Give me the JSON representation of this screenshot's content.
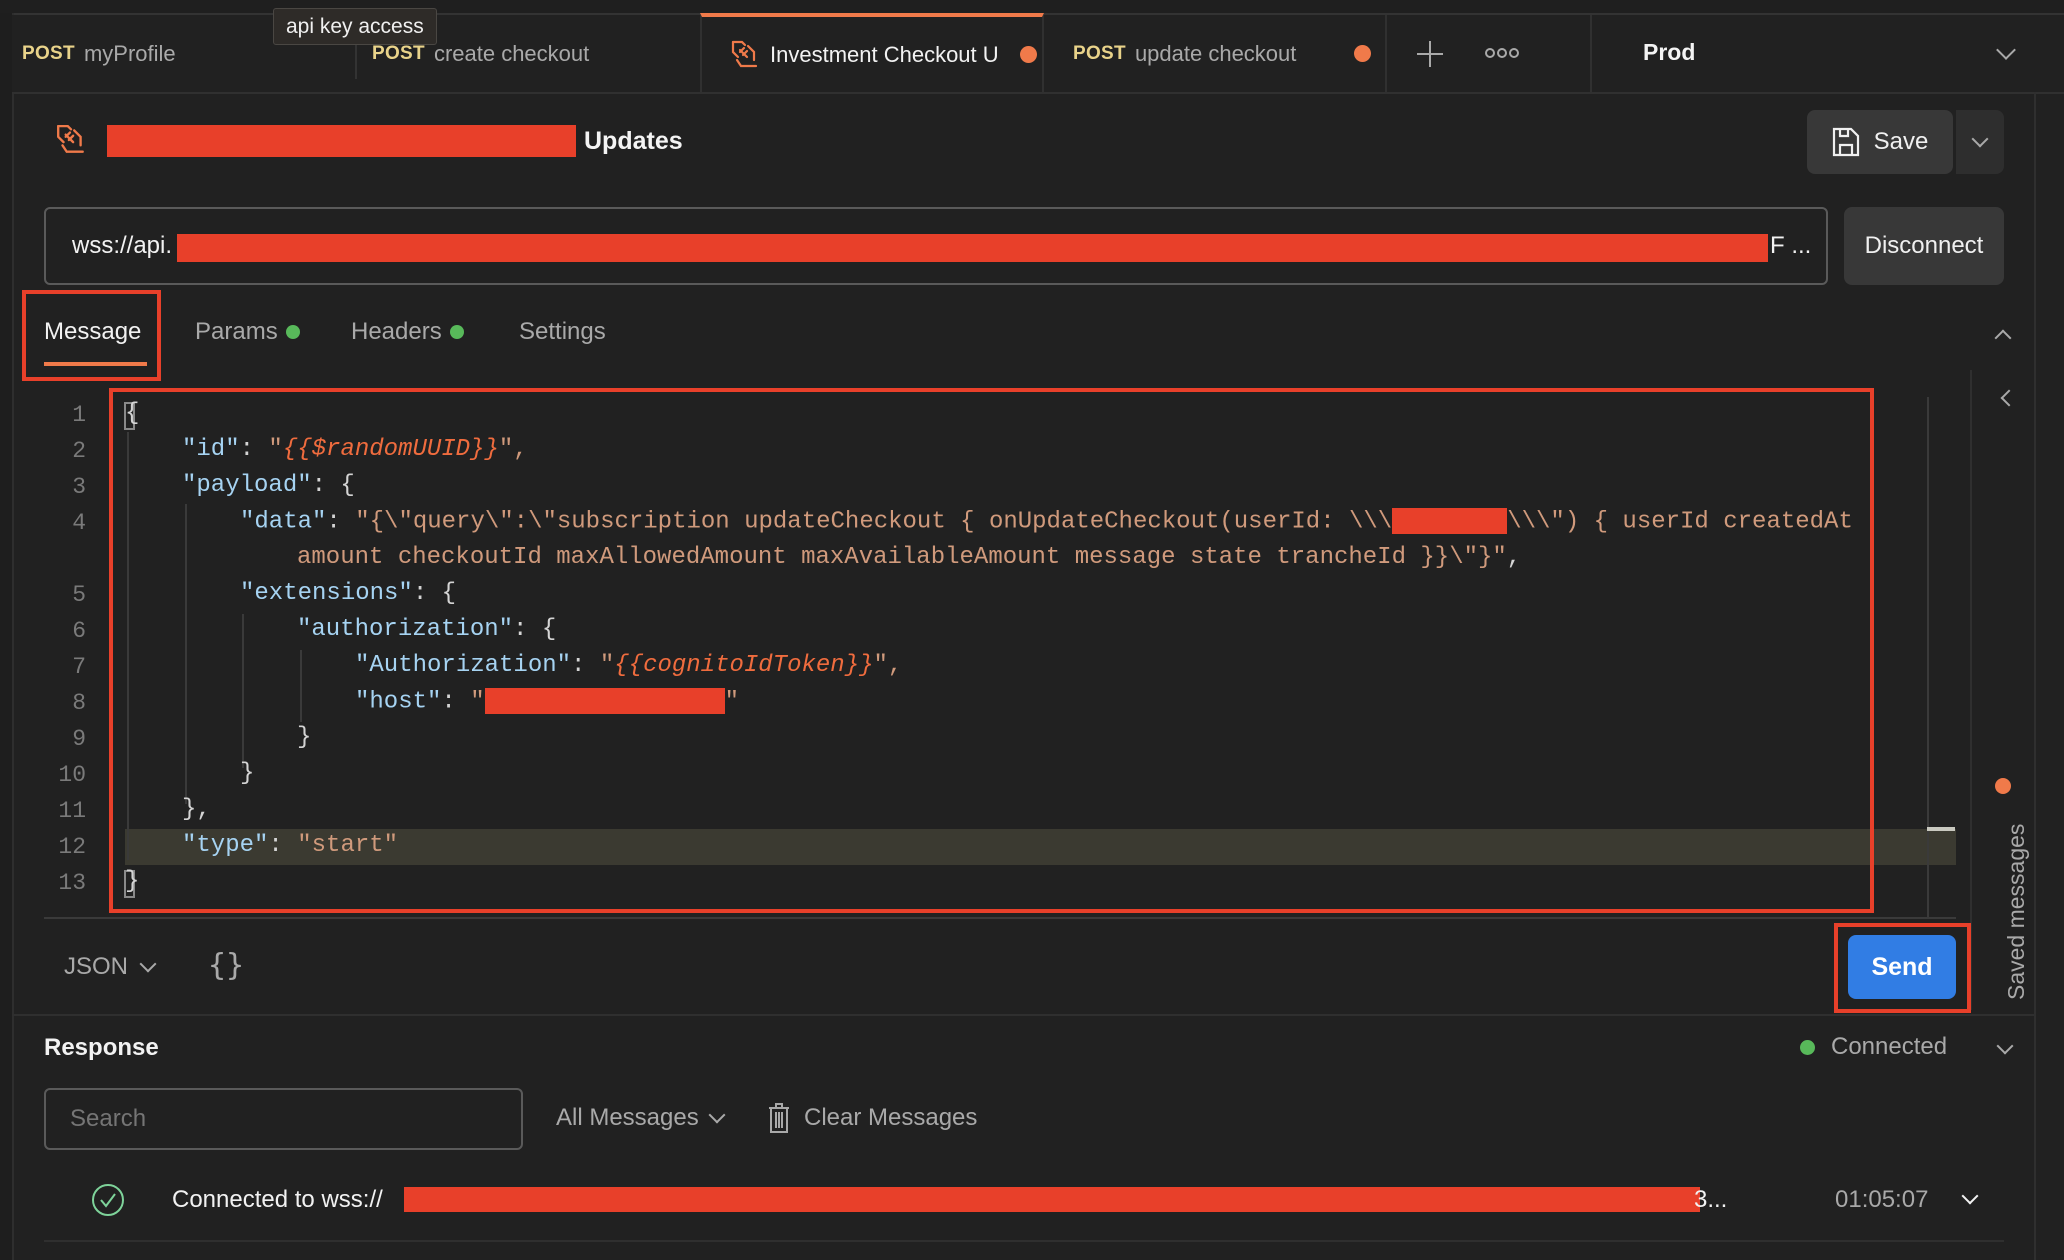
{
  "tooltip": "api key access",
  "tabs": [
    {
      "method": "POST",
      "label": "myProfile",
      "type": "http"
    },
    {
      "method": "POST",
      "label": "create checkout",
      "type": "http"
    },
    {
      "method": "",
      "label": "Investment Checkout U",
      "type": "websocket",
      "active": true,
      "unsaved": true
    },
    {
      "method": "POST",
      "label": "update checkout",
      "type": "http",
      "unsaved": true
    }
  ],
  "environment": {
    "selected": "Prod"
  },
  "request": {
    "title_suffix": "Updates",
    "save_label": "Save",
    "url_prefix": "wss://api.",
    "url_suffix": "F ...",
    "disconnect_label": "Disconnect"
  },
  "request_tabs": [
    {
      "label": "Message",
      "active": true
    },
    {
      "label": "Params",
      "indicator": true
    },
    {
      "label": "Headers",
      "indicator": true
    },
    {
      "label": "Settings"
    }
  ],
  "editor": {
    "line_numbers": [
      "1",
      "2",
      "3",
      "4",
      "",
      "5",
      "6",
      "7",
      "8",
      "9",
      "10",
      "11",
      "12",
      "13"
    ],
    "lines": {
      "l1": "{",
      "l2_key": "\"id\"",
      "l2_colon": ": ",
      "l2_q1": "\"",
      "l2_var": "{{$randomUUID}}",
      "l2_q2": "\",",
      "l3_key": "\"payload\"",
      "l3_rest": ": {",
      "l4_key": "\"data\"",
      "l4_colon": ": ",
      "l4_str_a": "\"{\\\"query\\\":\\\"subscription updateCheckout { onUpdateCheckout(userId: \\\\\\",
      "l4_str_b": "\\\\\\\") { userId createdAt",
      "l4_wrap": "amount checkoutId maxAllowedAmount maxAvailableAmount message state trancheId }}\\\"}\"",
      "l4_wrap_end": ",",
      "l5_key": "\"extensions\"",
      "l5_rest": ": {",
      "l6_key": "\"authorization\"",
      "l6_rest": ": {",
      "l7_key": "\"Authorization\"",
      "l7_colon": ": ",
      "l7_q1": "\"",
      "l7_var": "{{cognitoIdToken}}",
      "l7_q2": "\",",
      "l8_key": "\"host\"",
      "l8_colon": ": ",
      "l8_q1": "\"",
      "l8_q2": "\"",
      "l9": "}",
      "l10": "}",
      "l11": "},",
      "l12_key": "\"type\"",
      "l12_colon": ": ",
      "l12_val": "\"start\"",
      "l13": "}"
    },
    "language": "JSON",
    "format_icon": "{}",
    "send_label": "Send"
  },
  "saved_messages": {
    "label": "Saved messages",
    "has_new": true
  },
  "response": {
    "title": "Response",
    "status": "Connected",
    "search_placeholder": "Search",
    "filter": "All Messages",
    "clear_label": "Clear Messages",
    "messages": [
      {
        "text_prefix": "Connected to wss://",
        "text_suffix": "3...",
        "time": "01:05:07",
        "status": "connected"
      }
    ]
  },
  "colors": {
    "accent": "#f07a4a",
    "method_post": "#e9d38a",
    "send_button": "#317de4",
    "connected": "#58b95a",
    "annotation": "#e8402a"
  }
}
